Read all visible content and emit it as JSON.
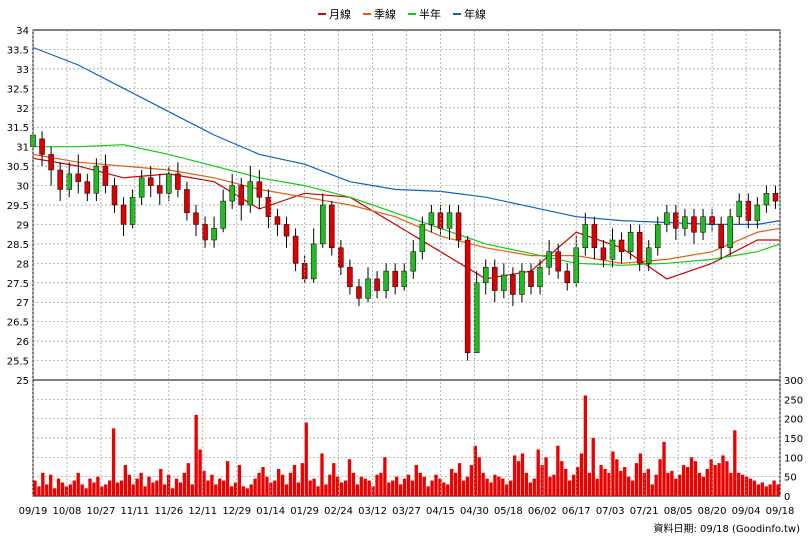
{
  "legend": [
    {
      "label": "月線",
      "color": "#cc0000"
    },
    {
      "label": "季線",
      "color": "#e06010"
    },
    {
      "label": "半年",
      "color": "#11cc11"
    },
    {
      "label": "年線",
      "color": "#1060c0"
    }
  ],
  "footer_text": "資料日期: 09/18 (Goodinfo.tw)",
  "chart_data": [
    {
      "type": "candlestick-line",
      "price_axis": {
        "ylim": [
          25,
          34
        ],
        "ticks": [
          "25",
          "25.5",
          "26",
          "26.5",
          "27",
          "27.5",
          "28",
          "28.5",
          "29",
          "29.5",
          "30",
          "30.5",
          "31",
          "31.5",
          "32",
          "32.5",
          "33",
          "33.5",
          "34"
        ]
      },
      "x_ticks": [
        "09/19",
        "10/08",
        "10/27",
        "11/11",
        "11/26",
        "12/11",
        "12/29",
        "01/14",
        "01/29",
        "02/24",
        "03/12",
        "03/27",
        "04/15",
        "04/30",
        "05/18",
        "06/02",
        "06/17",
        "07/03",
        "07/21",
        "08/05",
        "08/20",
        "09/04",
        "09/18"
      ],
      "grid": true,
      "colors": {
        "up": "#22bb22",
        "down": "#dd0000"
      },
      "series": [
        {
          "name": "月線",
          "color": "#cc0000",
          "x": [
            0,
            20,
            40,
            60,
            80,
            100,
            120,
            140,
            160,
            180,
            200,
            220,
            240,
            260,
            280,
            300,
            320,
            330
          ],
          "values": [
            30.7,
            30.5,
            30.2,
            30.3,
            30.1,
            29.4,
            29.8,
            29.7,
            29.0,
            28.3,
            27.6,
            27.8,
            28.8,
            28.4,
            27.6,
            28.0,
            28.6,
            28.6
          ]
        },
        {
          "name": "季線",
          "color": "#e06010",
          "x": [
            0,
            20,
            40,
            60,
            80,
            100,
            120,
            140,
            160,
            180,
            200,
            220,
            240,
            260,
            280,
            300,
            320,
            330
          ],
          "values": [
            30.8,
            30.6,
            30.5,
            30.4,
            30.2,
            29.9,
            29.7,
            29.5,
            29.2,
            28.7,
            28.4,
            28.2,
            28.2,
            28.0,
            28.1,
            28.3,
            28.8,
            28.9
          ]
        },
        {
          "name": "半年",
          "color": "#11cc11",
          "x": [
            0,
            20,
            40,
            60,
            80,
            100,
            120,
            140,
            160,
            180,
            200,
            220,
            240,
            260,
            280,
            300,
            320,
            330
          ],
          "values": [
            31.0,
            31.0,
            31.05,
            30.8,
            30.5,
            30.2,
            30.0,
            29.7,
            29.3,
            28.9,
            28.5,
            28.25,
            28.0,
            27.95,
            28.0,
            28.1,
            28.3,
            28.5
          ]
        },
        {
          "name": "年線",
          "color": "#1060c0",
          "x": [
            0,
            20,
            40,
            60,
            80,
            100,
            120,
            140,
            160,
            180,
            200,
            220,
            240,
            260,
            280,
            300,
            320,
            330
          ],
          "values": [
            33.55,
            33.1,
            32.5,
            31.9,
            31.3,
            30.8,
            30.55,
            30.1,
            29.9,
            29.85,
            29.7,
            29.45,
            29.2,
            29.1,
            29.05,
            29.0,
            29.0,
            29.1
          ]
        }
      ],
      "candles": [
        [
          0,
          31.0,
          31.3,
          31.6,
          30.8
        ],
        [
          4,
          31.2,
          30.8,
          31.4,
          30.5
        ],
        [
          8,
          30.8,
          30.4,
          31.0,
          30.0
        ],
        [
          12,
          30.4,
          29.9,
          30.6,
          29.6
        ],
        [
          16,
          29.9,
          30.3,
          30.6,
          29.7
        ],
        [
          20,
          30.3,
          30.1,
          30.8,
          29.8
        ],
        [
          24,
          30.1,
          29.8,
          30.3,
          29.6
        ],
        [
          28,
          29.8,
          30.5,
          30.7,
          29.6
        ],
        [
          32,
          30.5,
          30.0,
          30.8,
          29.8
        ],
        [
          36,
          30.0,
          29.5,
          30.2,
          29.3
        ],
        [
          40,
          29.5,
          29.0,
          29.7,
          28.7
        ],
        [
          44,
          29.0,
          29.7,
          29.9,
          28.9
        ],
        [
          48,
          29.7,
          30.2,
          30.4,
          29.5
        ],
        [
          52,
          30.2,
          30.0,
          30.5,
          29.7
        ],
        [
          56,
          30.0,
          29.8,
          30.3,
          29.5
        ],
        [
          60,
          29.8,
          30.3,
          30.5,
          29.6
        ],
        [
          64,
          30.3,
          29.9,
          30.6,
          29.7
        ],
        [
          68,
          29.9,
          29.3,
          30.1,
          29.1
        ],
        [
          72,
          29.3,
          29.0,
          29.5,
          28.7
        ],
        [
          76,
          29.0,
          28.6,
          29.2,
          28.4
        ],
        [
          80,
          28.6,
          28.9,
          29.2,
          28.4
        ],
        [
          84,
          28.9,
          29.6,
          29.9,
          28.8
        ],
        [
          88,
          29.6,
          30.0,
          30.3,
          29.4
        ],
        [
          92,
          30.0,
          29.5,
          30.2,
          29.1
        ],
        [
          96,
          29.5,
          30.1,
          30.5,
          29.3
        ],
        [
          100,
          30.1,
          29.7,
          30.4,
          29.4
        ],
        [
          104,
          29.7,
          29.2,
          29.9,
          28.9
        ],
        [
          108,
          29.2,
          29.0,
          29.4,
          28.7
        ],
        [
          112,
          29.0,
          28.7,
          29.2,
          28.4
        ],
        [
          116,
          28.7,
          28.0,
          28.9,
          27.8
        ],
        [
          120,
          28.0,
          27.6,
          28.2,
          27.5
        ],
        [
          124,
          27.6,
          28.5,
          28.9,
          27.5
        ],
        [
          128,
          28.5,
          29.5,
          29.8,
          28.4
        ],
        [
          132,
          29.5,
          28.4,
          29.6,
          28.2
        ],
        [
          136,
          28.4,
          27.9,
          28.6,
          27.7
        ],
        [
          140,
          27.9,
          27.4,
          28.1,
          27.2
        ],
        [
          144,
          27.4,
          27.1,
          27.6,
          26.9
        ],
        [
          148,
          27.1,
          27.6,
          27.9,
          27.0
        ],
        [
          152,
          27.6,
          27.3,
          27.8,
          27.1
        ],
        [
          156,
          27.3,
          27.8,
          28.0,
          27.1
        ],
        [
          160,
          27.8,
          27.4,
          28.0,
          27.2
        ],
        [
          164,
          27.4,
          27.8,
          28.0,
          27.3
        ],
        [
          168,
          27.8,
          28.3,
          28.6,
          27.6
        ],
        [
          172,
          28.3,
          29.0,
          29.2,
          28.1
        ],
        [
          176,
          29.0,
          29.3,
          29.5,
          28.8
        ],
        [
          180,
          29.3,
          28.9,
          29.5,
          28.7
        ],
        [
          184,
          28.9,
          29.3,
          29.5,
          28.6
        ],
        [
          188,
          29.3,
          28.6,
          29.5,
          28.4
        ],
        [
          192,
          28.6,
          25.7,
          28.7,
          25.5
        ],
        [
          196,
          25.7,
          27.5,
          27.8,
          25.9
        ],
        [
          200,
          27.5,
          27.9,
          28.1,
          27.2
        ],
        [
          204,
          27.9,
          27.3,
          28.1,
          27.0
        ],
        [
          208,
          27.3,
          27.7,
          28.0,
          27.1
        ],
        [
          212,
          27.7,
          27.2,
          27.9,
          26.9
        ],
        [
          216,
          27.2,
          27.8,
          28.0,
          27.0
        ],
        [
          220,
          27.8,
          27.4,
          28.0,
          27.2
        ],
        [
          224,
          27.4,
          27.9,
          28.1,
          27.2
        ],
        [
          228,
          27.9,
          28.3,
          28.6,
          27.7
        ],
        [
          232,
          28.3,
          27.8,
          28.5,
          27.6
        ],
        [
          236,
          27.8,
          27.5,
          28.0,
          27.3
        ],
        [
          240,
          27.5,
          28.4,
          28.7,
          27.4
        ],
        [
          244,
          28.4,
          29.0,
          29.3,
          28.2
        ],
        [
          248,
          29.0,
          28.4,
          29.2,
          28.1
        ],
        [
          252,
          28.4,
          28.1,
          28.6,
          27.9
        ],
        [
          256,
          28.1,
          28.6,
          28.9,
          27.9
        ],
        [
          260,
          28.6,
          28.3,
          28.8,
          28.0
        ],
        [
          264,
          28.3,
          28.8,
          29.0,
          28.1
        ],
        [
          268,
          28.8,
          28.0,
          29.0,
          27.8
        ],
        [
          272,
          28.0,
          28.4,
          28.6,
          27.8
        ],
        [
          276,
          28.4,
          29.0,
          29.2,
          28.2
        ],
        [
          280,
          29.0,
          29.3,
          29.5,
          28.8
        ],
        [
          284,
          29.3,
          28.9,
          29.5,
          28.6
        ],
        [
          288,
          28.9,
          29.2,
          29.4,
          28.7
        ],
        [
          292,
          29.2,
          28.8,
          29.4,
          28.5
        ],
        [
          296,
          28.8,
          29.2,
          29.4,
          28.6
        ],
        [
          300,
          29.2,
          29.0,
          29.4,
          28.8
        ],
        [
          304,
          29.0,
          28.4,
          29.2,
          28.1
        ],
        [
          308,
          28.4,
          29.2,
          29.4,
          28.2
        ],
        [
          312,
          29.2,
          29.6,
          29.8,
          29.0
        ],
        [
          316,
          29.6,
          29.1,
          29.8,
          28.9
        ],
        [
          320,
          29.1,
          29.5,
          29.7,
          28.9
        ],
        [
          324,
          29.5,
          29.8,
          30.0,
          29.3
        ],
        [
          328,
          29.8,
          29.6,
          30.0,
          29.4
        ]
      ],
      "volume_axis": {
        "ylim": [
          0,
          300
        ],
        "ticks": [
          "0",
          "50",
          "100",
          "150",
          "200",
          "250",
          "300"
        ]
      },
      "volume": [
        40,
        25,
        60,
        30,
        55,
        20,
        45,
        35,
        25,
        30,
        40,
        60,
        30,
        20,
        45,
        35,
        50,
        25,
        30,
        40,
        175,
        35,
        40,
        80,
        55,
        30,
        45,
        60,
        25,
        50,
        35,
        40,
        70,
        30,
        55,
        20,
        45,
        35,
        60,
        85,
        30,
        210,
        120,
        65,
        40,
        55,
        30,
        45,
        40,
        90,
        25,
        35,
        80,
        25,
        20,
        30,
        45,
        60,
        75,
        50,
        35,
        40,
        70,
        55,
        30,
        60,
        80,
        35,
        85,
        190,
        40,
        45,
        25,
        110,
        30,
        55,
        85,
        50,
        35,
        40,
        95,
        60,
        30,
        50,
        45,
        40,
        25,
        55,
        60,
        100,
        35,
        40,
        50,
        30,
        45,
        55,
        40,
        80,
        60,
        50,
        25,
        40,
        55,
        45,
        35,
        30,
        70,
        60,
        85,
        40,
        50,
        80,
        130,
        100,
        60,
        45,
        35,
        55,
        50,
        45,
        30,
        40,
        105,
        90,
        110,
        60,
        35,
        45,
        120,
        80,
        100,
        50,
        55,
        130,
        90,
        70,
        40,
        55,
        75,
        110,
        260,
        60,
        150,
        45,
        80,
        70,
        60,
        115,
        95,
        65,
        75,
        50,
        40,
        85,
        110,
        60,
        70,
        30,
        55,
        95,
        140,
        60,
        65,
        45,
        55,
        80,
        75,
        100,
        90,
        60,
        50,
        70,
        95,
        80,
        85,
        105,
        90,
        60,
        170,
        60,
        55,
        50,
        45,
        40,
        30,
        35,
        25,
        30,
        40,
        30
      ]
    }
  ]
}
